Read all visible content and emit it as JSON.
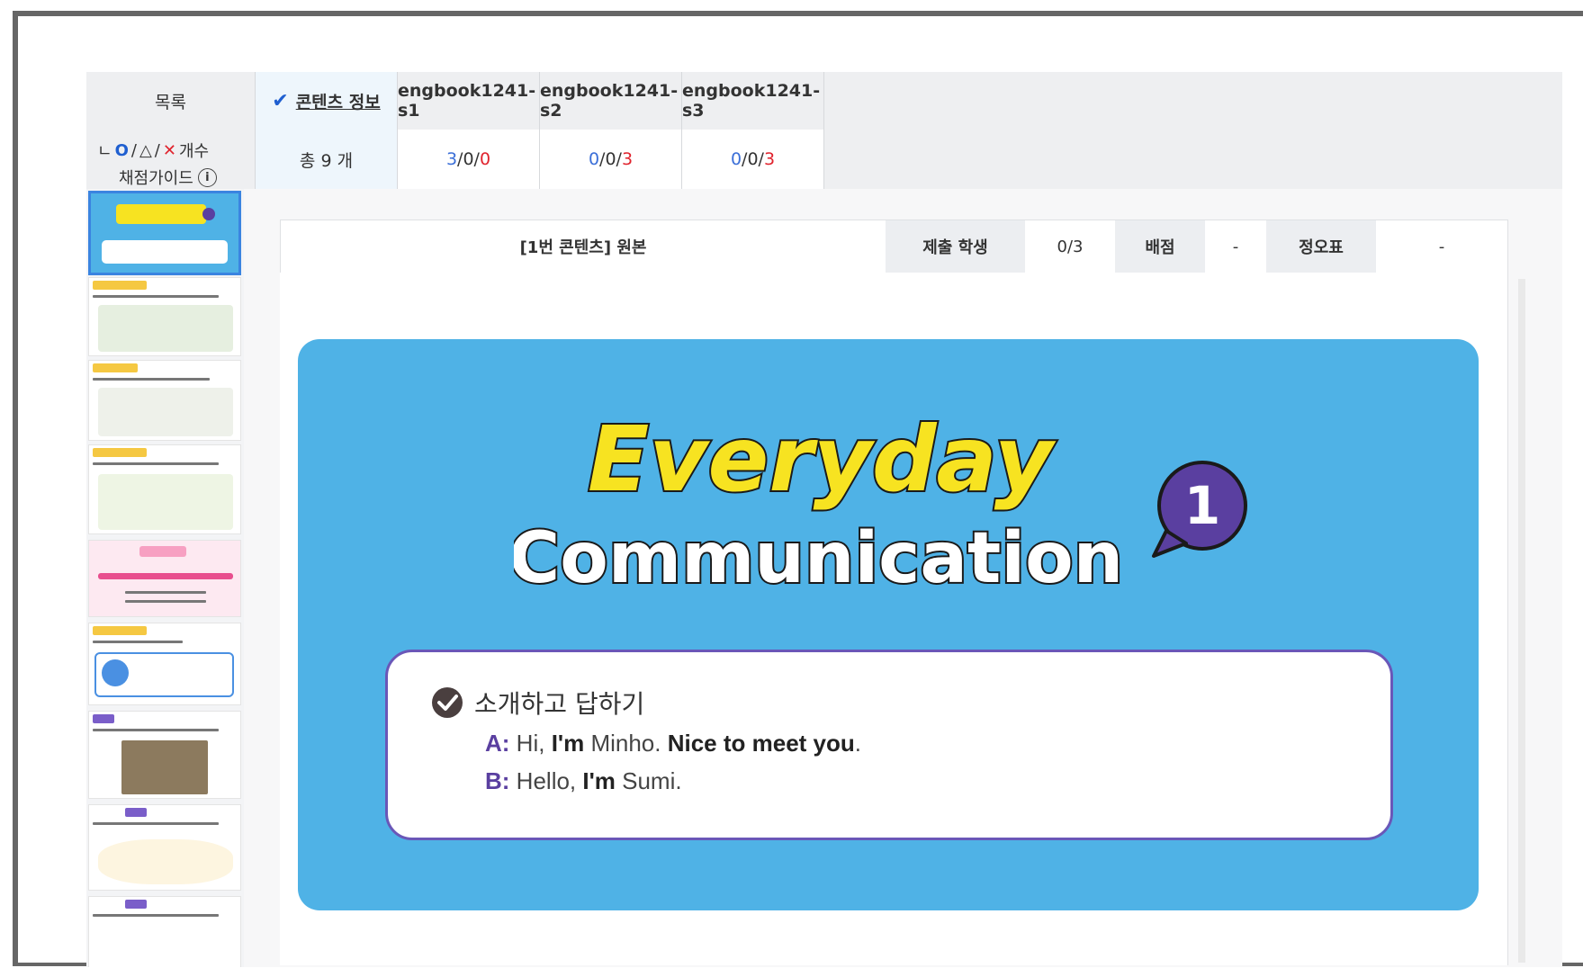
{
  "header": {
    "list_label": "목록",
    "tabs": [
      {
        "label": "콘텐츠 정보",
        "active": true
      },
      {
        "label": "engbook1241-s1"
      },
      {
        "label": "engbook1241-s2"
      },
      {
        "label": "engbook1241-s3"
      }
    ]
  },
  "guide": {
    "prefix": "ㄴ",
    "circle": "O",
    "slash1": "/",
    "triangle": "△",
    "slash2": "/",
    "xmark": "✕",
    "count": "개수",
    "grading_guide": "채점가이드",
    "info_icon": "i"
  },
  "summary": {
    "total": "총 9 개",
    "s1": {
      "a": "3",
      "b": "0",
      "c": "0"
    },
    "s2": {
      "a": "0",
      "b": "0",
      "c": "3"
    },
    "s3": {
      "a": "0",
      "b": "0",
      "c": "3"
    },
    "separator": "/"
  },
  "subbar": {
    "content_title": "[1번 콘텐츠] 원본",
    "submit_label": "제출 학생",
    "submit_value": "0/3",
    "score_label": "배점",
    "score_value": "-",
    "table_label": "정오표",
    "table_value": "-"
  },
  "slide": {
    "title_line1": "Everyday",
    "title_line2": "Communication",
    "badge_number": "1",
    "dialog_title": "소개하고 답하기",
    "lines": [
      {
        "speaker": "A",
        "colon": ":",
        "t1": " Hi, ",
        "b1": "I'm",
        "t2": " Minho. ",
        "b2": "Nice to meet you",
        "t3": "."
      },
      {
        "speaker": "B",
        "colon": ":",
        "t1": " Hello, ",
        "b1": "I'm",
        "t2": " Sumi."
      }
    ]
  },
  "colors": {
    "slide_bg": "#4fb2e6",
    "accent_blue": "#3b6fd8",
    "accent_red": "#e0232d",
    "dialog_border": "#6a57b8",
    "title_yellow": "#f7e321"
  },
  "icons": [
    "check-icon",
    "info-icon",
    "check-circle-icon",
    "speech-bubble-icon"
  ]
}
